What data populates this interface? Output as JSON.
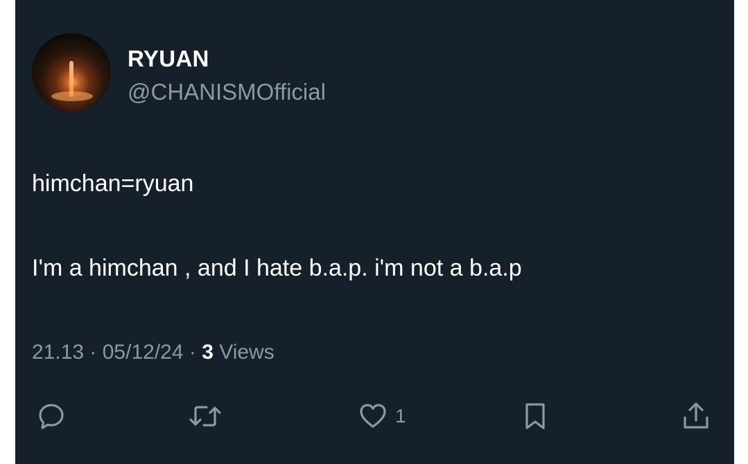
{
  "author": {
    "display_name": "RYUAN",
    "handle": "@CHANISMOfficial",
    "avatar_icon": "profile-avatar"
  },
  "tweet": {
    "line1": "himchan=ryuan",
    "line2": "I'm a himchan , and I hate b.a.p. i'm not a b.a.p"
  },
  "meta": {
    "time": "21.13",
    "separator": " · ",
    "date": "05/12/24",
    "views_count": "3",
    "views_label": " Views"
  },
  "actions": {
    "reply_icon": "reply-icon",
    "retweet_icon": "retweet-icon",
    "like_icon": "heart-icon",
    "like_count": "1",
    "bookmark_icon": "bookmark-icon",
    "share_icon": "share-icon"
  },
  "colors": {
    "background": "#15202b",
    "primary_text": "#ffffff",
    "secondary_text": "#8b98a5"
  }
}
